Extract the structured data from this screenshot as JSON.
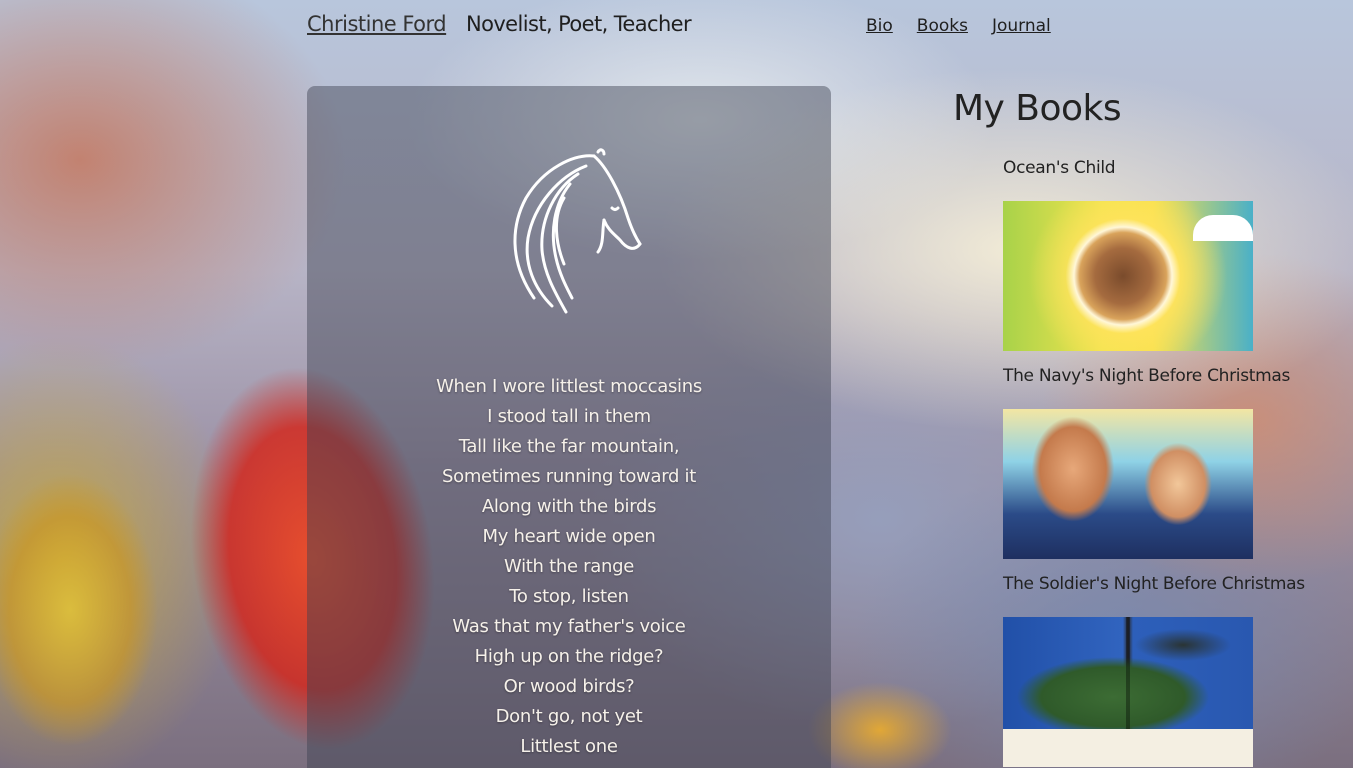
{
  "header": {
    "site_name": "Christine Ford",
    "tagline": "Novelist, Poet, Teacher",
    "nav": [
      "Bio",
      "Books",
      "Journal"
    ]
  },
  "poem": {
    "lines": [
      "When I wore littlest moccasins",
      "I stood tall in them",
      "Tall like the far mountain,",
      "Sometimes running toward it",
      "Along with the birds",
      "My heart wide open",
      "With the range",
      "To stop, listen",
      "Was that my father's voice",
      "High up on the ridge?",
      "Or wood birds?",
      "Don't go, not yet",
      "Littlest one"
    ]
  },
  "books": {
    "heading": "My Books",
    "items": [
      {
        "title": "Ocean's Child"
      },
      {
        "title": "The Navy's Night Before Christmas"
      },
      {
        "title": "The Soldier's Night Before Christmas"
      }
    ]
  }
}
